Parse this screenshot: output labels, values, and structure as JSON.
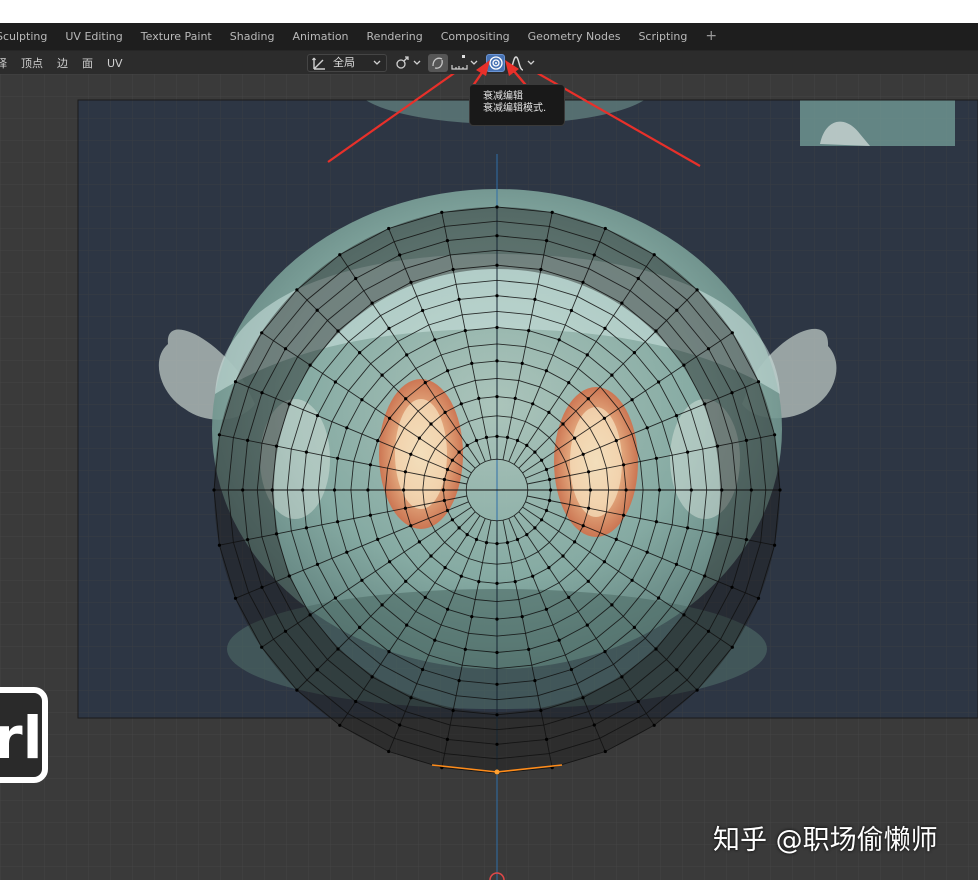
{
  "workspace_tabs": [
    "Sculpting",
    "UV Editing",
    "Texture Paint",
    "Shading",
    "Animation",
    "Rendering",
    "Compositing",
    "Geometry Nodes",
    "Scripting",
    "+"
  ],
  "header_menu": [
    "择",
    "顶点",
    "边",
    "面",
    "UV"
  ],
  "toolbar": {
    "pivot_icon": "pivot-transform-icon",
    "pivot_label": "全局",
    "snap_icon": "snap-link-icon",
    "sync_icon": "uv-sync-icon",
    "snap_increment_icon": "snap-increment-icon",
    "proportional_icon": "proportional-editing-icon",
    "falloff_icon": "falloff-curve-icon"
  },
  "tooltip": {
    "title": "衰减编辑",
    "description": "衰减编辑模式."
  },
  "overlay": {
    "key_hint": "rl",
    "watermark": "知乎 @职场偷懒师"
  },
  "colors": {
    "tab_bar": "#1e1e1e",
    "toolbar": "#2c2c2c",
    "viewport": "#3a3a3a",
    "active_button": "#4772b3",
    "arrow": "#e8302a",
    "selection": "#ff8c1a"
  }
}
